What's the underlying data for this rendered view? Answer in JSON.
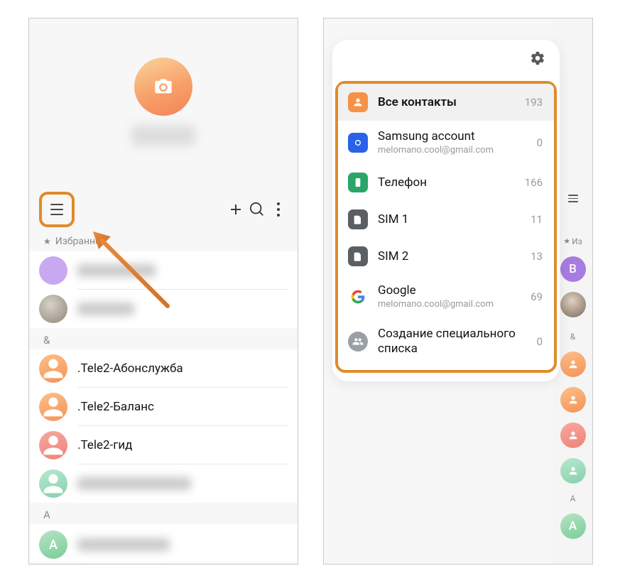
{
  "left": {
    "sections": {
      "favorites_label": "Избранное",
      "amp": "&",
      "a": "А"
    },
    "contacts": {
      "tele2_abon": ".Tele2-Абонслужба",
      "tele2_balance": ".Tele2-Баланс",
      "tele2_gid": ".Tele2-гид"
    }
  },
  "right": {
    "strip": {
      "fav_abbrev": "Из",
      "amp": "&",
      "a": "А",
      "big_b": "В",
      "big_a": "А"
    },
    "panel": {
      "all_contacts": {
        "label": "Все контакты",
        "count": "193"
      },
      "samsung": {
        "label": "Samsung account",
        "sub": "melomano.cool@gmail.com",
        "count": "0"
      },
      "phone": {
        "label": "Телефон",
        "count": "166"
      },
      "sim1": {
        "label": "SIM 1",
        "count": "11"
      },
      "sim2": {
        "label": "SIM 2",
        "count": "13"
      },
      "google": {
        "label": "Google",
        "sub": "melomano.cool@gmail.com",
        "count": "69"
      },
      "custom": {
        "label": "Создание специального списка",
        "count": "0"
      }
    }
  }
}
